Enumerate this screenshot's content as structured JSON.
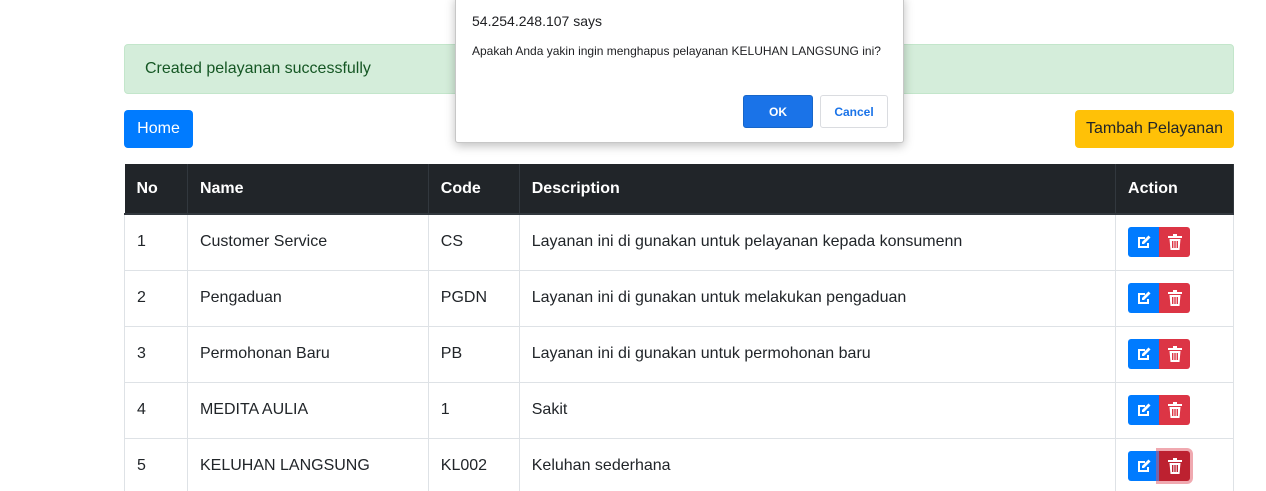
{
  "alert": {
    "message": "Created pelayanan successfully"
  },
  "toolbar": {
    "home_label": "Home",
    "add_label": "Tambah Pelayanan"
  },
  "table": {
    "headers": {
      "no": "No",
      "name": "Name",
      "code": "Code",
      "description": "Description",
      "action": "Action"
    },
    "rows": [
      {
        "no": "1",
        "name": "Customer Service",
        "code": "CS",
        "description": "Layanan ini di gunakan untuk pelayanan kepada konsumenn"
      },
      {
        "no": "2",
        "name": "Pengaduan",
        "code": "PGDN",
        "description": "Layanan ini di gunakan untuk melakukan pengaduan"
      },
      {
        "no": "3",
        "name": "Permohonan Baru",
        "code": "PB",
        "description": "Layanan ini di gunakan untuk permohonan baru"
      },
      {
        "no": "4",
        "name": "MEDITA AULIA",
        "code": "1",
        "description": "Sakit"
      },
      {
        "no": "5",
        "name": "KELUHAN LANGSUNG",
        "code": "KL002",
        "description": "Keluhan sederhana"
      }
    ],
    "edit_icon": "edit-icon",
    "delete_icon": "trash-icon"
  },
  "dialog": {
    "origin": "54.254.248.107 says",
    "message": "Apakah Anda yakin ingin menghapus pelayanan KELUHAN LANGSUNG ini?",
    "ok_label": "OK",
    "cancel_label": "Cancel"
  },
  "colors": {
    "primary": "#007bff",
    "warning": "#ffc107",
    "danger": "#dc3545",
    "success_bg": "#d4edda",
    "success_text": "#155724",
    "table_head": "#212529",
    "dialog_accent": "#1a73e8"
  }
}
